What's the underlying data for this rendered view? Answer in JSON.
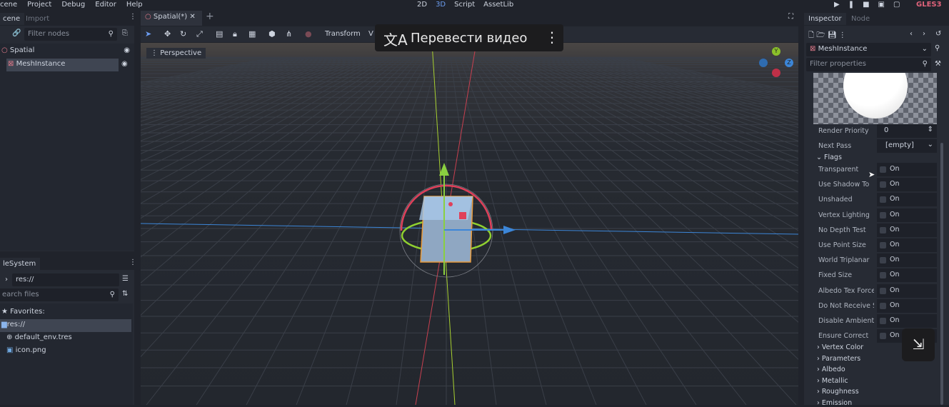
{
  "menu": [
    "cene",
    "Project",
    "Debug",
    "Editor",
    "Help"
  ],
  "workspaces": [
    "2D",
    "3D",
    "Script",
    "AssetLib"
  ],
  "renderer": "GLES3",
  "scene_dock": {
    "tabs": [
      "cene",
      "Import"
    ],
    "filter_placeholder": "Filter nodes",
    "nodes": [
      "Spatial",
      "MeshInstance"
    ]
  },
  "filesystem": {
    "tab": "leSystem",
    "path": "res://",
    "search_placeholder": "earch files",
    "favorites": "Favorites:",
    "items": [
      "res://",
      "default_env.tres",
      "icon.png"
    ]
  },
  "editor": {
    "tab": "Spatial(*)",
    "toolbar": {
      "transform": "Transform",
      "view": "V"
    },
    "viewport_label": "Perspective"
  },
  "translate_popup": {
    "text": "Перевести видео"
  },
  "gizmo": {
    "y": "Y",
    "z": "Z"
  },
  "inspector": {
    "tabs": [
      "Inspector",
      "Node"
    ],
    "node": "MeshInstance",
    "filter_placeholder": "Filter properties",
    "render_priority": {
      "label": "Render Priority",
      "value": "0"
    },
    "next_pass": {
      "label": "Next Pass",
      "value": "[empty]"
    },
    "flags_header": "Flags",
    "flags": [
      {
        "label": "Transparent",
        "value": "On"
      },
      {
        "label": "Use Shadow To",
        "value": "On"
      },
      {
        "label": "Unshaded",
        "value": "On"
      },
      {
        "label": "Vertex Lighting",
        "value": "On"
      },
      {
        "label": "No Depth Test",
        "value": "On"
      },
      {
        "label": "Use Point Size",
        "value": "On"
      },
      {
        "label": "World Triplanar",
        "value": "On"
      },
      {
        "label": "Fixed Size",
        "value": "On"
      },
      {
        "label": "Albedo Tex Force",
        "value": "On"
      },
      {
        "label": "Do Not Receive S",
        "value": "On"
      },
      {
        "label": "Disable Ambient",
        "value": "On"
      },
      {
        "label": "Ensure Correct",
        "value": "On"
      }
    ],
    "sections": [
      "Vertex Color",
      "Parameters",
      "Albedo",
      "Metallic",
      "Roughness",
      "Emission"
    ]
  }
}
